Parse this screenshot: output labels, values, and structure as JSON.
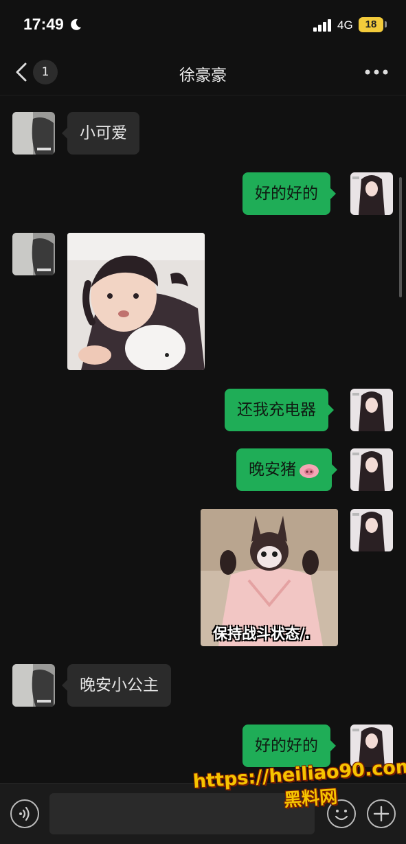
{
  "status_bar": {
    "time": "17:49",
    "network": "4G",
    "battery": "18"
  },
  "nav": {
    "unread_count": "1",
    "title": "徐豪豪"
  },
  "messages": [
    {
      "dir": "in",
      "type": "text",
      "text": "小可爱"
    },
    {
      "dir": "out",
      "type": "text",
      "text": "好的好的"
    },
    {
      "dir": "in",
      "type": "sticker",
      "sticker": "toddler-pouting-sticker"
    },
    {
      "dir": "out",
      "type": "text",
      "text": "还我充电器"
    },
    {
      "dir": "out",
      "type": "text",
      "text": "晚安猪",
      "emoji": "pig-face-emoji"
    },
    {
      "dir": "out",
      "type": "sticker",
      "sticker": "doll-bunny-ears-sticker",
      "caption": "保持战斗状态/."
    },
    {
      "dir": "in",
      "type": "text",
      "text": "晚安小公主"
    },
    {
      "dir": "out",
      "type": "text",
      "text": "好的好的"
    }
  ],
  "watermark": {
    "url": "https://heiliao90.com",
    "name": "黑料网"
  },
  "colors": {
    "background": "#111111",
    "outgoing_bubble": "#1fad57",
    "incoming_bubble": "#2b2b2b",
    "battery": "#f3cb3b"
  },
  "icons": [
    "moon-icon",
    "signal-icon",
    "back-icon",
    "more-icon",
    "voice-icon",
    "emoji-icon",
    "plus-icon"
  ]
}
